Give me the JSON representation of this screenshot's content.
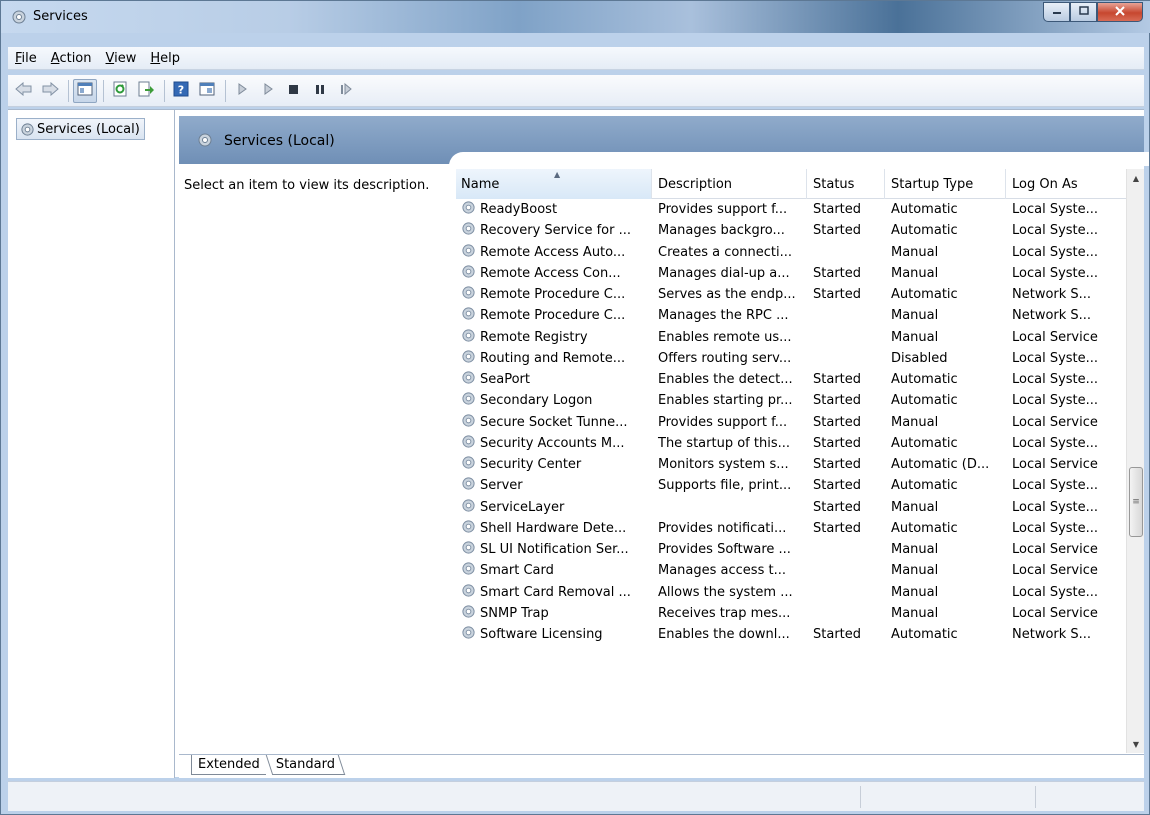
{
  "window": {
    "title": "Services"
  },
  "menu": [
    {
      "pre": "",
      "key": "F",
      "post": "ile"
    },
    {
      "pre": "",
      "key": "A",
      "post": "ction"
    },
    {
      "pre": "",
      "key": "V",
      "post": "iew"
    },
    {
      "pre": "",
      "key": "H",
      "post": "elp"
    }
  ],
  "toolbar": {
    "icons": [
      "back-icon",
      "forward-icon",
      "show-hide-tree-icon",
      "refresh-icon",
      "export-list-icon",
      "help-icon",
      "properties-icon",
      "start-service-icon",
      "start-service-alt-icon",
      "stop-service-icon",
      "pause-service-icon",
      "resume-service-icon"
    ]
  },
  "tree": {
    "root_label": "Services (Local)"
  },
  "pane": {
    "title": "Services (Local)",
    "description_prompt": "Select an item to view its description."
  },
  "table": {
    "columns": [
      "Name",
      "Description",
      "Status",
      "Startup Type",
      "Log On As"
    ],
    "rows": [
      [
        "ReadyBoost",
        "Provides support f...",
        "Started",
        "Automatic",
        "Local Syste..."
      ],
      [
        "Recovery Service for ...",
        "Manages backgro...",
        "Started",
        "Automatic",
        "Local Syste..."
      ],
      [
        "Remote Access Auto...",
        "Creates a connecti...",
        "",
        "Manual",
        "Local Syste..."
      ],
      [
        "Remote Access Con...",
        "Manages dial-up a...",
        "Started",
        "Manual",
        "Local Syste..."
      ],
      [
        "Remote Procedure C...",
        "Serves as the endp...",
        "Started",
        "Automatic",
        "Network S..."
      ],
      [
        "Remote Procedure C...",
        "Manages the RPC ...",
        "",
        "Manual",
        "Network S..."
      ],
      [
        "Remote Registry",
        "Enables remote us...",
        "",
        "Manual",
        "Local Service"
      ],
      [
        "Routing and Remote...",
        "Offers routing serv...",
        "",
        "Disabled",
        "Local Syste..."
      ],
      [
        "SeaPort",
        "Enables the detect...",
        "Started",
        "Automatic",
        "Local Syste..."
      ],
      [
        "Secondary Logon",
        "Enables starting pr...",
        "Started",
        "Automatic",
        "Local Syste..."
      ],
      [
        "Secure Socket Tunne...",
        "Provides support f...",
        "Started",
        "Manual",
        "Local Service"
      ],
      [
        "Security Accounts M...",
        "The startup of this...",
        "Started",
        "Automatic",
        "Local Syste..."
      ],
      [
        "Security Center",
        "Monitors system s...",
        "Started",
        "Automatic (D...",
        "Local Service"
      ],
      [
        "Server",
        "Supports file, print...",
        "Started",
        "Automatic",
        "Local Syste..."
      ],
      [
        "ServiceLayer",
        "",
        "Started",
        "Manual",
        "Local Syste..."
      ],
      [
        "Shell Hardware Dete...",
        "Provides notificati...",
        "Started",
        "Automatic",
        "Local Syste..."
      ],
      [
        "SL UI Notification Ser...",
        "Provides Software ...",
        "",
        "Manual",
        "Local Service"
      ],
      [
        "Smart Card",
        "Manages access t...",
        "",
        "Manual",
        "Local Service"
      ],
      [
        "Smart Card Removal ...",
        "Allows the system ...",
        "",
        "Manual",
        "Local Syste..."
      ],
      [
        "SNMP Trap",
        "Receives trap mes...",
        "",
        "Manual",
        "Local Service"
      ],
      [
        "Software Licensing",
        "Enables the downl...",
        "Started",
        "Automatic",
        "Network S..."
      ]
    ]
  },
  "tabs": [
    "Extended",
    "Standard"
  ]
}
